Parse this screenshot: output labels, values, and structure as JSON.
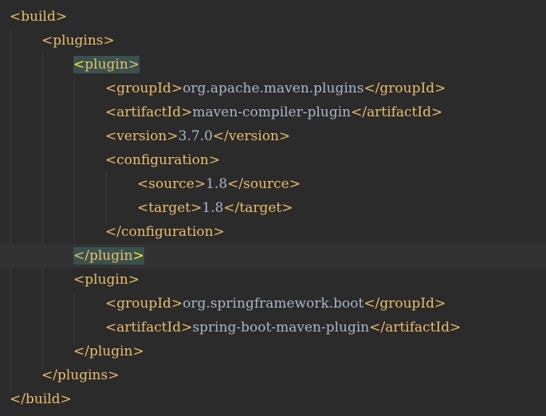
{
  "lines": [
    {
      "indent": 0,
      "open": "<build>"
    },
    {
      "indent": 1,
      "open": "<plugins>"
    },
    {
      "indent": 2,
      "bracket_l": "<",
      "tag": "plugin",
      "bracket_r": ">"
    },
    {
      "indent": 3,
      "open": "<groupId>",
      "text": "org.apache.maven.plugins",
      "close": "</groupId>"
    },
    {
      "indent": 3,
      "open": "<artifactId>",
      "text": "maven-compiler-plugin",
      "close": "</artifactId>"
    },
    {
      "indent": 3,
      "open": "<version>",
      "text": "3.7.0",
      "close": "</version>"
    },
    {
      "indent": 3,
      "open": "<configuration>"
    },
    {
      "indent": 4,
      "open": "<source>",
      "text": "1.8",
      "close": "</source>"
    },
    {
      "indent": 4,
      "open": "<target>",
      "text": "1.8",
      "close": "</target>"
    },
    {
      "indent": 3,
      "open": "</configuration>"
    },
    {
      "indent": 2,
      "bracket_l": "</",
      "tag": "plugin",
      "bracket_r": ">"
    },
    {
      "indent": 2,
      "open": "<plugin>"
    },
    {
      "indent": 3,
      "open": "<groupId>",
      "text": "org.springframework.boot",
      "close": "</groupId>"
    },
    {
      "indent": 3,
      "open": "<artifactId>",
      "text": "spring-boot-maven-plugin",
      "close": "</artifactId>"
    },
    {
      "indent": 2,
      "open": "</plugin>"
    },
    {
      "indent": 1,
      "open": "</plugins>"
    },
    {
      "indent": 0,
      "open": "</build>"
    }
  ],
  "colors": {
    "background": "#2b2b2b",
    "current_line": "#323232",
    "tag": "#e8bf6a",
    "text": "#a9b7c6",
    "brace_match_bg": "#3b514d",
    "brace_match_fg": "#ffef28"
  }
}
